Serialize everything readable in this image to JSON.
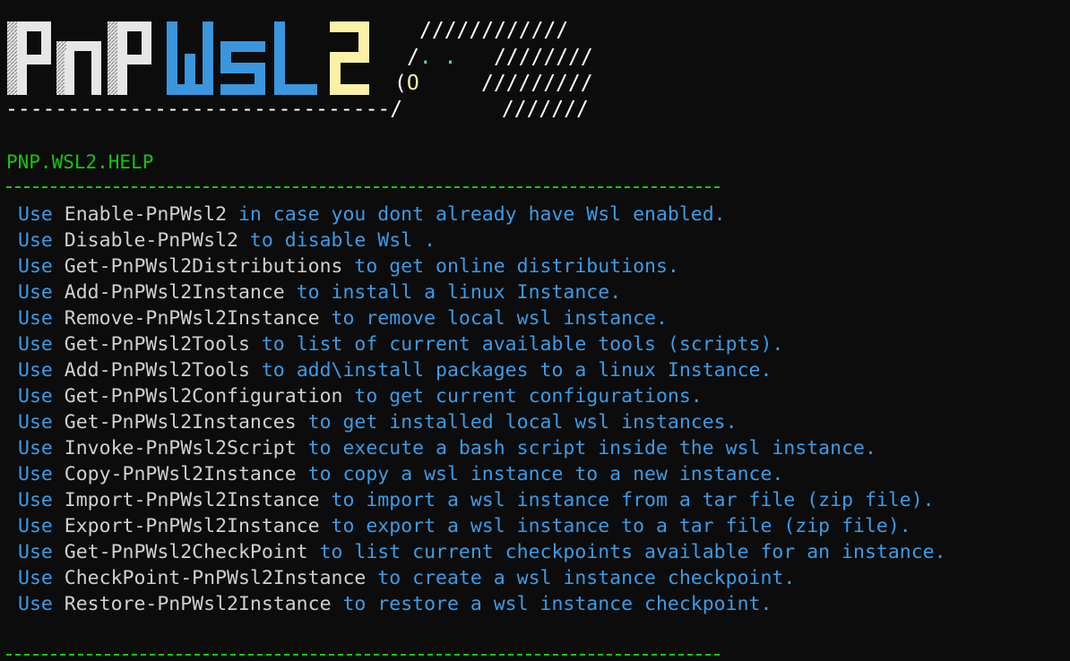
{
  "logo": {
    "text": "PnPWSL2",
    "part1": "PnP",
    "part2": "WSL",
    "part3": "2",
    "colors": {
      "part1": "#e6e6e6",
      "part2": "#3a96dd",
      "part3": "#f9f1a5"
    }
  },
  "ascii": {
    "line1": "////////////",
    "line2_slash": "/",
    "line2_eyes": ". .",
    "line2_rest": "////////",
    "line3_paren": "(",
    "line3_nose": "O",
    "line3_rest": "/////////",
    "line4_dashes": "-------------------------------/",
    "line4_rest": "///////"
  },
  "help": {
    "title": "PNP.WSL2.HELP",
    "use_keyword": "Use",
    "items": [
      {
        "command": "Enable-PnPWsl2",
        "description": "in case you dont already have Wsl enabled."
      },
      {
        "command": "Disable-PnPWsl2",
        "description": "to disable Wsl ."
      },
      {
        "command": "Get-PnPWsl2Distributions",
        "description": "to get online distributions."
      },
      {
        "command": "Add-PnPWsl2Instance",
        "description": "to install a linux Instance."
      },
      {
        "command": "Remove-PnPWsl2Instance",
        "description": "to remove local wsl instance."
      },
      {
        "command": "Get-PnPWsl2Tools",
        "description": "to list of current available tools (scripts)."
      },
      {
        "command": "Add-PnPWsl2Tools",
        "description": "to add\\install packages to a linux Instance."
      },
      {
        "command": "Get-PnPWsl2Configuration",
        "description": "to get current configurations."
      },
      {
        "command": "Get-PnPWsl2Instances",
        "description": "to get installed local wsl instances."
      },
      {
        "command": "Invoke-PnPWsl2Script",
        "description": "to execute a bash script inside the wsl instance."
      },
      {
        "command": "Copy-PnPWsl2Instance",
        "description": "to copy a wsl instance to a new instance."
      },
      {
        "command": "Import-PnPWsl2Instance",
        "description": "to import a wsl instance from a tar file (zip file)."
      },
      {
        "command": "Export-PnPWsl2Instance",
        "description": "to export a wsl instance to a tar file (zip file)."
      },
      {
        "command": "Get-PnPWsl2CheckPoint",
        "description": "to list current checkpoints available for an instance."
      },
      {
        "command": "CheckPoint-PnPWsl2Instance",
        "description": "to create a wsl instance checkpoint."
      },
      {
        "command": "Restore-PnPWsl2Instance",
        "description": "to restore a wsl instance checkpoint."
      }
    ]
  }
}
